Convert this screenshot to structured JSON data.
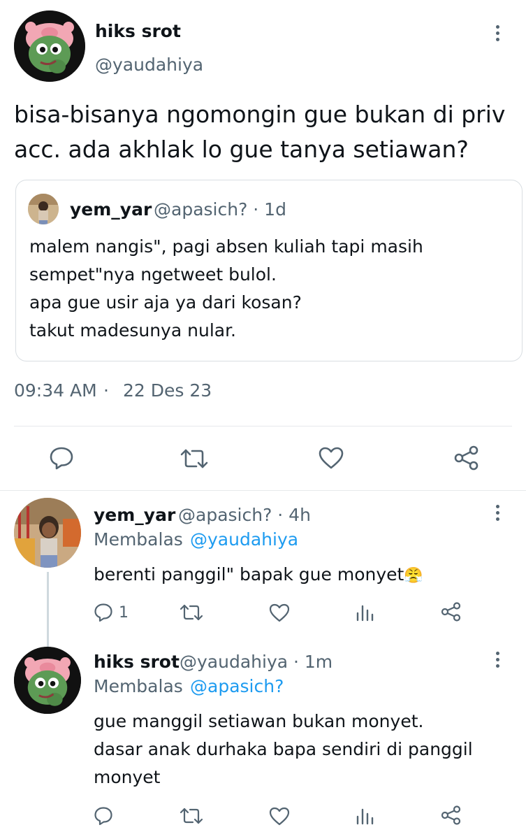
{
  "main_tweet": {
    "display_name": "hiks srot",
    "handle": "@yaudahiya",
    "text_line1": "bisa-bisanya ngomongin gue bukan di priv",
    "text_line2": "acc. ada akhlak lo gue tanya setiawan?",
    "time": "09:34 AM",
    "separator": "·",
    "date": "22 Des 23"
  },
  "quoted_tweet": {
    "display_name": "yem_yar",
    "handle_age": "@apasich? · 1d",
    "lines": [
      "malem nangis\", pagi absen kuliah tapi masih",
      "sempet\"nya ngetweet bulol.",
      "apa gue usir aja ya dari kosan?",
      "takut madesunya nular."
    ]
  },
  "replies": [
    {
      "display_name": "yem_yar",
      "handle_age": "@apasich? · 4h",
      "replying_prefix": "Membalas",
      "replying_to": "@yaudahiya",
      "text": "berenti panggil\" bapak gue monyet",
      "emoji": "😤",
      "reply_count": "1"
    },
    {
      "display_name": "hiks srot",
      "handle_age": "@yaudahiya · 1m",
      "replying_prefix": "Membalas",
      "replying_to": "@apasich?",
      "lines": [
        "gue manggil setiawan bukan monyet.",
        "dasar anak durhaka bapa sendiri di panggil",
        "monyet"
      ]
    }
  ],
  "icons": {
    "reply": "reply-icon",
    "retweet": "retweet-icon",
    "like": "like-icon",
    "share": "share-icon",
    "views": "views-icon",
    "more": "more-icon"
  },
  "colors": {
    "text": "#0f1419",
    "muted": "#536471",
    "link": "#1d9bf0",
    "border": "#d9dee2"
  }
}
